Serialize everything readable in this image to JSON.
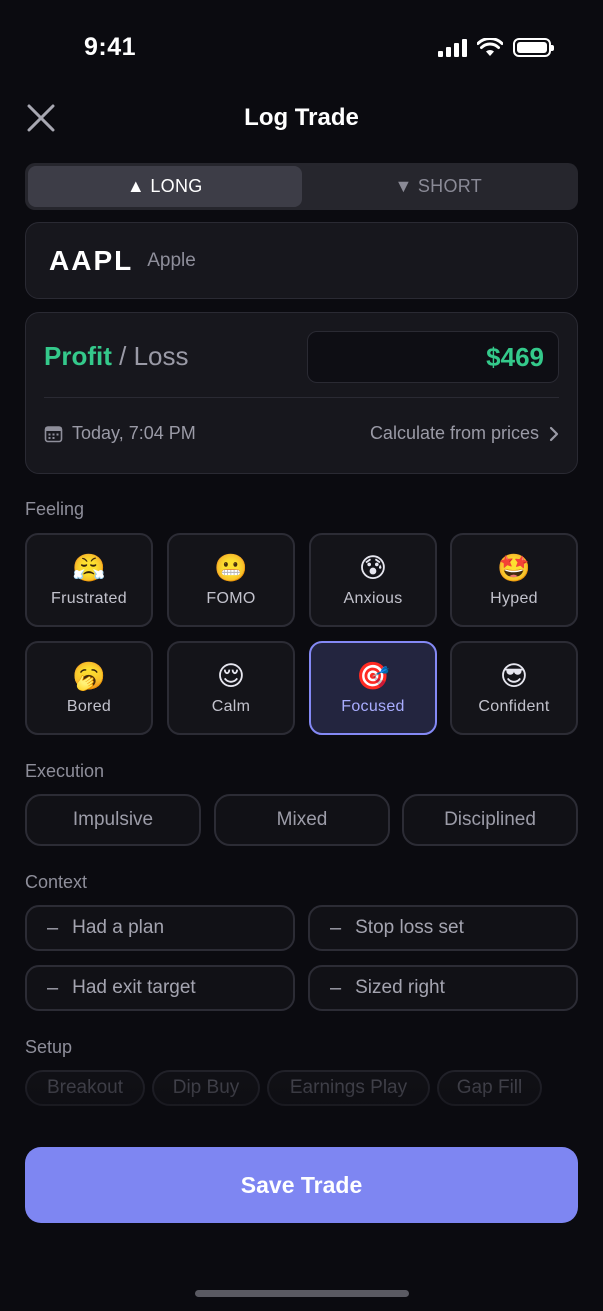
{
  "status_bar": {
    "time": "9:41"
  },
  "header": {
    "title": "Log Trade"
  },
  "direction": {
    "long_label": "▲ LONG",
    "short_label": "▼ SHORT",
    "selected": "long"
  },
  "ticker": {
    "symbol": "AAPL",
    "name": "Apple"
  },
  "pnl": {
    "profit_label": "Profit",
    "separator": " / ",
    "loss_label": "Loss",
    "amount": "$469",
    "date": "Today, 7:04 PM",
    "calc_link": "Calculate from prices"
  },
  "feeling": {
    "label": "Feeling",
    "options": [
      {
        "emoji": "😤",
        "label": "Frustrated"
      },
      {
        "emoji": "😬",
        "label": "FOMO"
      },
      {
        "emoji": "😰",
        "label": "Anxious"
      },
      {
        "emoji": "🤩",
        "label": "Hyped"
      },
      {
        "emoji": "🥱",
        "label": "Bored"
      },
      {
        "emoji": "😌",
        "label": "Calm"
      },
      {
        "emoji": "🎯",
        "label": "Focused"
      },
      {
        "emoji": "😎",
        "label": "Confident"
      }
    ],
    "selected": "Focused"
  },
  "execution": {
    "label": "Execution",
    "options": [
      "Impulsive",
      "Mixed",
      "Disciplined"
    ]
  },
  "context": {
    "label": "Context",
    "options": [
      "Had a plan",
      "Stop loss set",
      "Had exit target",
      "Sized right"
    ]
  },
  "setup": {
    "label": "Setup",
    "options": [
      "Breakout",
      "Dip Buy",
      "Earnings Play",
      "Gap Fill"
    ]
  },
  "save_button": {
    "label": "Save Trade"
  },
  "colors": {
    "accent": "#7e86f2",
    "profit": "#34c98b",
    "background": "#0b0b10"
  }
}
